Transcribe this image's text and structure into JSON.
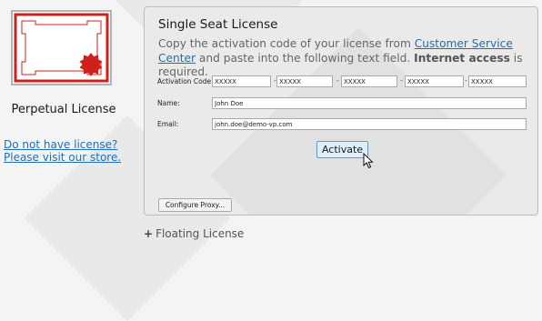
{
  "left": {
    "certificate_icon": "license-certificate-icon",
    "license_type_label": "Perpetual License",
    "store_link_line1": "Do not have license?",
    "store_link_line2": "Please visit our store."
  },
  "panel": {
    "title": "Single Seat License",
    "description_pre": "Copy the activation code of your license from ",
    "description_link": "Customer Service Center",
    "description_mid": " and paste into the following text field. ",
    "description_bold": "Internet access",
    "description_post": " is required.",
    "activation_code_label": "Activation Code:",
    "activation_code_parts": [
      "XXXXX",
      "XXXXX",
      "XXXXX",
      "XXXXX",
      "XXXXX"
    ],
    "separator": "-",
    "name_label": "Name:",
    "name_value": "John Doe",
    "email_label": "Email:",
    "email_value": "john.doe@demo-vp.com",
    "activate_label": "Activate",
    "proxy_label": "Configure Proxy..."
  },
  "floating": {
    "plus": "+",
    "label": "Floating License"
  },
  "colors": {
    "accent_red": "#d0201c",
    "link_blue": "#1f6fb8",
    "button_border": "#5b9bd5"
  }
}
